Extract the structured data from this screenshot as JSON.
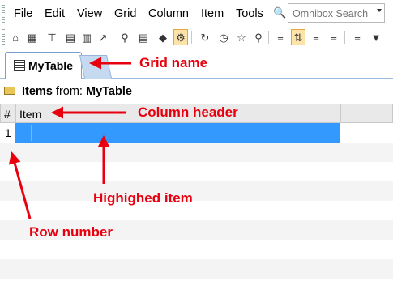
{
  "menu": {
    "items": [
      "File",
      "Edit",
      "View",
      "Grid",
      "Column",
      "Item",
      "Tools"
    ]
  },
  "omnibox": {
    "placeholder": "Omnibox Search"
  },
  "toolbar": {
    "icons": [
      "home-icon",
      "calendar-icon",
      "tree-icon",
      "notes-icon",
      "notes-edit-icon",
      "export-icon",
      "preview-icon",
      "document-icon",
      "tag-icon",
      "settings-icon",
      "refresh-icon",
      "clock-icon",
      "star-icon",
      "search-icon",
      "list-icon",
      "sort-icon",
      "outline-icon",
      "filter-list-icon",
      "filter-icon"
    ]
  },
  "tab": {
    "label": "MyTable"
  },
  "items_header": {
    "prefix": "Items",
    "middle": " from: ",
    "source": "MyTable"
  },
  "grid": {
    "headers": [
      "#",
      "Item"
    ],
    "rows": [
      {
        "num": "1",
        "item": ""
      }
    ]
  },
  "annotations": {
    "grid_name": "Grid name",
    "column_header": "Column header",
    "highlighted_item": "Highighed item",
    "row_number": "Row number"
  },
  "colors": {
    "selection": "#3399ff",
    "annotation": "#e8000e"
  }
}
